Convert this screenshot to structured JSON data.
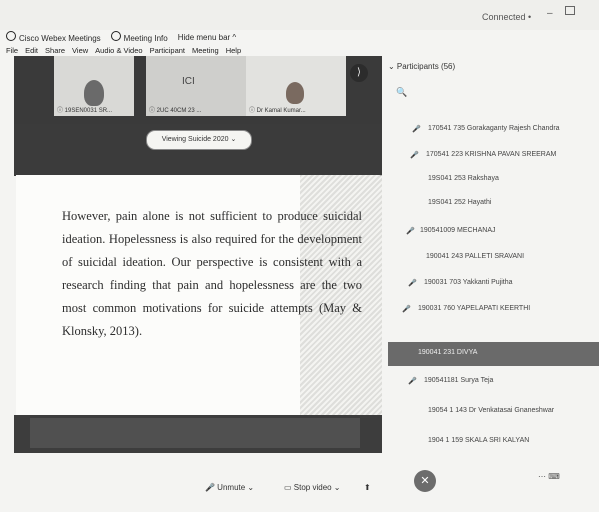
{
  "window": {
    "connected_label": "Connected •",
    "min_glyph": "–"
  },
  "titlebar": {
    "app_name": "Cisco Webex Meetings",
    "meeting_info": "Meeting Info",
    "hide_menu": "Hide menu bar ^"
  },
  "menu": [
    "File",
    "Edit",
    "Share",
    "View",
    "Audio & Video",
    "Participant",
    "Meeting",
    "Help"
  ],
  "video_strip": {
    "tiles": [
      {
        "caption": "ⓘ 19SEN0031 SR..."
      },
      {
        "caption": "ⓘ 2UC 40CM 23 ..."
      },
      {
        "caption": "ⓘ Dr Kamal Kumar..."
      }
    ],
    "tile2_initials": "ICI",
    "next_label": "⟩"
  },
  "viewing_button": "Viewing Suicide 2020 ⌄",
  "slide": {
    "text": "However, pain alone is not sufficient to produce suicidal ideation. Hopelessness is also required for the development of suicidal ideation. Our perspective is consistent with a research finding that pain and hopelessness are the two most common motivations for suicide attempts (May & Klonsky, 2013)."
  },
  "controls": {
    "unmute": "🎤 Unmute ⌄",
    "stop_video": "▭ Stop video ⌄",
    "share": "⬆",
    "end": "✕",
    "right_icons": "⋯   ⌨"
  },
  "participants": {
    "header": "⌄ Participants (56)",
    "search_icon": "🔍",
    "rows": [
      {
        "icon": "",
        "name": "",
        "highlight": false
      },
      {
        "icon": "🎤",
        "name": "170541 735 Gorakaganty Rajesh Chandra",
        "highlight": false
      },
      {
        "icon": "🎤",
        "name": "170541 223 KRISHNA PAVAN SREERAM",
        "highlight": false
      },
      {
        "icon": "",
        "name": "19S041 253 Rakshaya",
        "highlight": false
      },
      {
        "icon": "",
        "name": "19S041 252 Hayathi",
        "highlight": false
      },
      {
        "icon": "🎤",
        "name": "190541009 MECHANAJ",
        "highlight": false
      },
      {
        "icon": "",
        "name": "190041 243 PALLETI SRAVANI",
        "highlight": false
      },
      {
        "icon": "🎤",
        "name": "190031 703 Yakkanti Pujitha",
        "highlight": false
      },
      {
        "icon": "🎤",
        "name": "190031 760 YAPELAPATI KEERTHI",
        "highlight": false
      },
      {
        "icon": "",
        "name": "190041 231 DIVYA",
        "highlight": true
      },
      {
        "icon": "🎤",
        "name": "190541181 Surya Teja",
        "highlight": false
      },
      {
        "icon": "",
        "name": "19054 1 143 Dr Venkatasai Gnaneshwar",
        "highlight": false
      },
      {
        "icon": "",
        "name": "1904 1 159 SKALA SRI KALYAN",
        "highlight": false
      }
    ]
  }
}
